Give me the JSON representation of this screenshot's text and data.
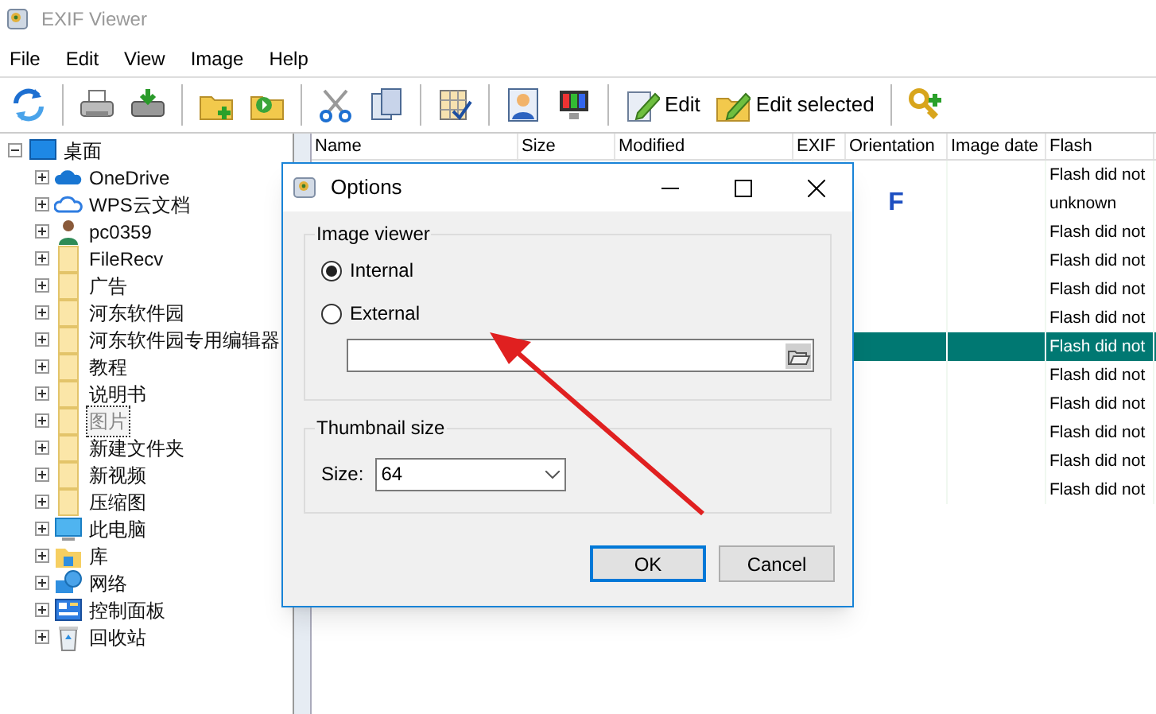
{
  "window": {
    "title": "EXIF Viewer"
  },
  "menu": [
    "File",
    "Edit",
    "View",
    "Image",
    "Help"
  ],
  "toolbar": {
    "edit_label": "Edit",
    "edit_selected_label": "Edit selected"
  },
  "tree": {
    "label": "桌面",
    "expanded": true,
    "children": [
      {
        "label": "OneDrive",
        "expanded": false,
        "focused": false
      },
      {
        "label": "WPS云文档",
        "expanded": false,
        "focused": false
      },
      {
        "label": "pc0359",
        "expanded": false,
        "focused": false
      },
      {
        "label": "FileRecv",
        "expanded": false,
        "focused": false
      },
      {
        "label": "广告",
        "expanded": false,
        "focused": false
      },
      {
        "label": "河东软件园",
        "expanded": false,
        "focused": false
      },
      {
        "label": "河东软件园专用编辑器",
        "expanded": false,
        "focused": false
      },
      {
        "label": "教程",
        "expanded": false,
        "focused": false
      },
      {
        "label": "说明书",
        "expanded": false,
        "focused": false
      },
      {
        "label": "图片",
        "expanded": false,
        "focused": true
      },
      {
        "label": "新建文件夹",
        "expanded": false,
        "focused": false
      },
      {
        "label": "新视频",
        "expanded": false,
        "focused": false
      },
      {
        "label": "压缩图",
        "expanded": false,
        "focused": false
      },
      {
        "label": "此电脑",
        "expanded": false,
        "focused": false
      },
      {
        "label": "库",
        "expanded": false,
        "focused": false
      },
      {
        "label": "网络",
        "expanded": false,
        "focused": false
      },
      {
        "label": "控制面板",
        "expanded": false,
        "focused": false
      },
      {
        "label": "回收站",
        "expanded": false,
        "focused": false
      }
    ]
  },
  "table": {
    "columns": [
      "Name",
      "Size",
      "Modified",
      "EXIF",
      "Orientation",
      "Image date",
      "Flash"
    ],
    "rows": [
      {
        "orientation": "",
        "flash": "Flash did not",
        "selected": false
      },
      {
        "orientation": "F",
        "flash": "unknown",
        "selected": false
      },
      {
        "orientation": "",
        "flash": "Flash did not",
        "selected": false
      },
      {
        "orientation": "",
        "flash": "Flash did not",
        "selected": false
      },
      {
        "orientation": "",
        "flash": "Flash did not",
        "selected": false
      },
      {
        "orientation": "",
        "flash": "Flash did not",
        "selected": false
      },
      {
        "orientation": "",
        "flash": "Flash did not",
        "selected": true
      },
      {
        "orientation": "",
        "flash": "Flash did not",
        "selected": false
      },
      {
        "orientation": "",
        "flash": "Flash did not",
        "selected": false
      },
      {
        "orientation": "",
        "flash": "Flash did not",
        "selected": false
      },
      {
        "orientation": "",
        "flash": "Flash did not",
        "selected": false
      },
      {
        "orientation": "",
        "flash": "Flash did not",
        "selected": false
      }
    ]
  },
  "dialog": {
    "title": "Options",
    "image_viewer": {
      "title": "Image viewer",
      "options": [
        {
          "label": "Internal",
          "selected": true
        },
        {
          "label": "External",
          "selected": false
        }
      ]
    },
    "thumbnail": {
      "title": "Thumbnail size",
      "size_label": "Size:",
      "size_value": "64"
    },
    "buttons": [
      {
        "label": "OK",
        "default": true
      },
      {
        "label": "Cancel",
        "default": false
      }
    ]
  }
}
